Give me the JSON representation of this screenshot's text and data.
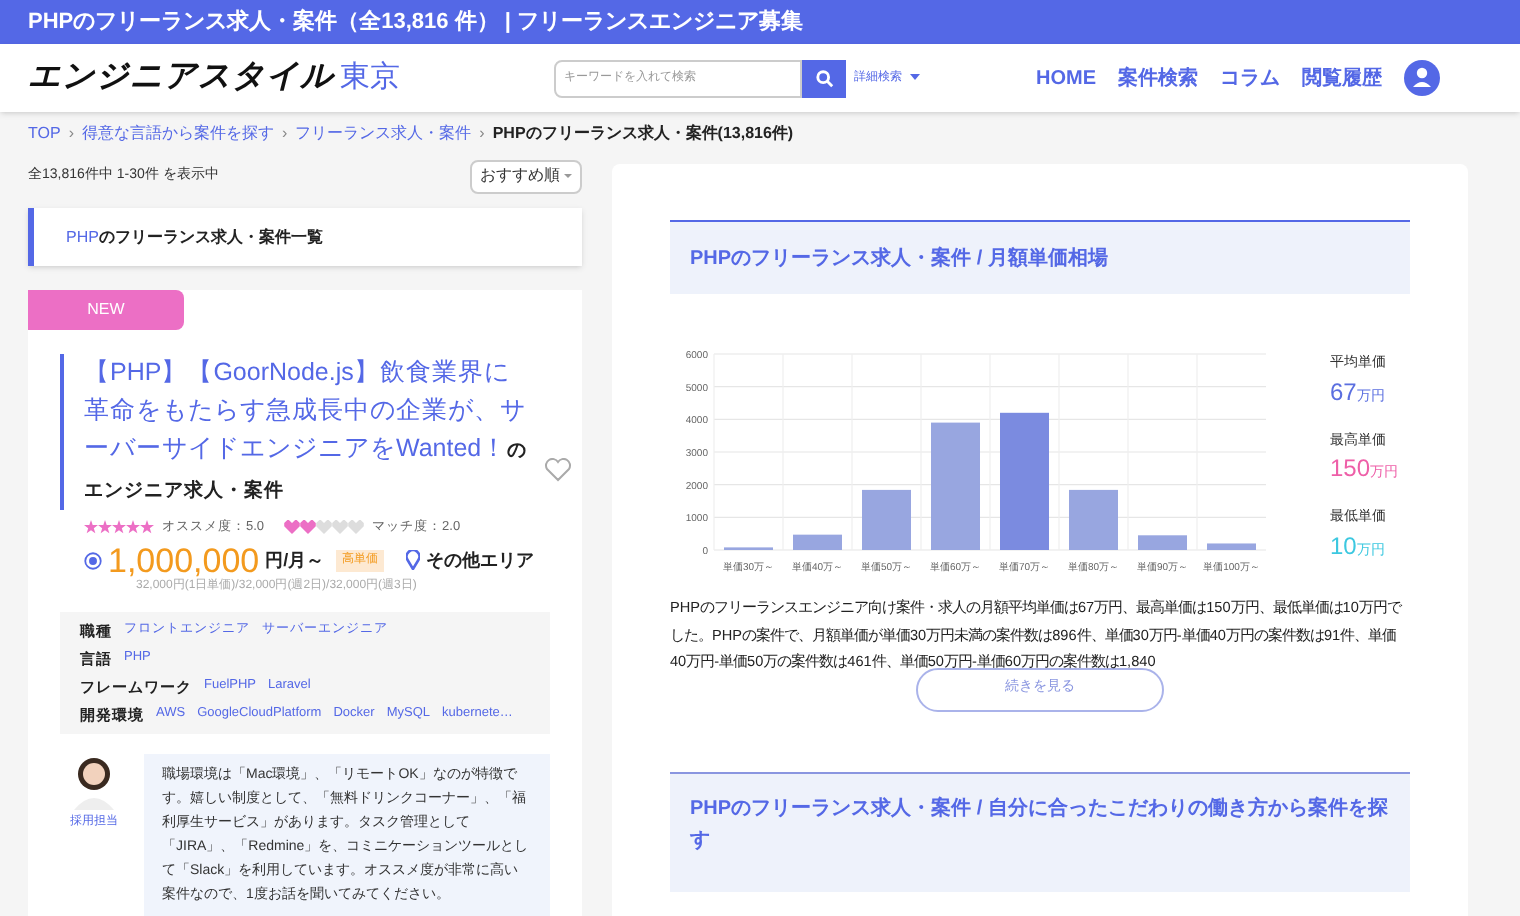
{
  "top_banner": {
    "title": "PHPのフリーランス求人・案件（全13,816 件） | フリーランスエンジニア募集"
  },
  "header": {
    "logo": "エンジニアスタイル",
    "logo_region": "東京",
    "search": {
      "placeholder": "キーワードを入れて検索"
    },
    "advanced_search": "詳細検索",
    "nav": [
      "HOME",
      "案件検索",
      "コラム",
      "閲覧履歴"
    ]
  },
  "breadcrumb": [
    {
      "label": "TOP",
      "link": true,
      "separator": "›"
    },
    {
      "label": "得意な言語から案件を探す",
      "link": true,
      "separator": "›"
    },
    {
      "label": "フリーランス求人・案件",
      "link": true,
      "separator": "›"
    },
    {
      "label": "PHPのフリーランス求人・案件(13,816件)",
      "link": false
    }
  ],
  "result_count": "全13,816件中 1-30件 を表示中",
  "sort": "おすすめ順",
  "list_heading": {
    "keyword": "PHP",
    "rest": "のフリーランス求人・案件一覧"
  },
  "job": {
    "badge": "NEW",
    "title": "【PHP】【GoorNode.js】飲食業界に革命をもたらす急成長中の企業が、サーバーサイドエンジニアをWanted！",
    "title_suffix": "のエンジニア求人・案件",
    "favorite": false,
    "recommend": {
      "stars": 5,
      "label": "オススメ度：5.0"
    },
    "match": {
      "stars": 2,
      "label": "マッチ度：2.0"
    },
    "price": "1,000,000",
    "price_unit": "円/月～",
    "price_tag": "高単価",
    "area": "その他エリア",
    "price_detail": "32,000円(1日単価)/32,000円(週2日)/32,000円(週3日)",
    "details": [
      {
        "label": "職種",
        "values": [
          "フロントエンジニア",
          "サーバーエンジニア"
        ]
      },
      {
        "label": "言語",
        "values": [
          "PHP"
        ]
      },
      {
        "label": "フレームワーク",
        "values": [
          "FuelPHP",
          "Laravel"
        ]
      },
      {
        "label": "開発環境",
        "values": [
          "AWS",
          "GoogleCloudPlatform",
          "Docker",
          "MySQL",
          "kubernete…"
        ]
      }
    ],
    "recruiter": "採用担当",
    "comment": "職場環境は「Mac環境」、「リモートOK」なのが特徴です。嬉しい制度として、「無料ドリンクコーナー」、「福利厚生サービス」があります。タスク管理として「JIRA」、「Redmine」を、コミニケーションツールとして「Slack」を利用しています。オススメ度が非常に高い案件なので、1度お話を聞いてみてください。"
  },
  "price_section": {
    "heading": "PHPのフリーランス求人・案件 / 月額単価相場",
    "chart_data": {
      "type": "bar",
      "categories": [
        "単価30万～",
        "単価40万～",
        "単価50万～",
        "単価60万～",
        "単価70万～",
        "単価80万～",
        "単価90万～",
        "単価100万～"
      ],
      "values": [
        80,
        470,
        1840,
        3900,
        4200,
        1840,
        450,
        200
      ],
      "ylim": [
        0,
        6000
      ],
      "grid": true,
      "yticks": [
        0,
        1000,
        2000,
        3000,
        4000,
        5000,
        6000
      ]
    },
    "stats": [
      {
        "label": "平均単価",
        "value": "67",
        "unit": "万円",
        "color": "#5b6fe0"
      },
      {
        "label": "最高単価",
        "value": "150",
        "unit": "万円",
        "color": "#ee5fa8"
      },
      {
        "label": "最低単価",
        "value": "10",
        "unit": "万円",
        "color": "#3cc8e0"
      }
    ],
    "description": "PHPのフリーランスエンジニア向け案件・求人の月額平均単価は67万円、最高単価は150万円、最低単価は10万円でした。PHPの案件で、月額単価が単価30万円未満の案件数は896件、単価30万円-単価40万円の案件数は91件、単価40万円-単価50万の案件数は461件、単価50万円-単価60万円の案件数は1,840",
    "more_button": "続きを見る"
  },
  "style_section": {
    "heading": "PHPのフリーランス求人・案件 / 自分に合ったこだわりの働き方から案件を探す"
  }
}
